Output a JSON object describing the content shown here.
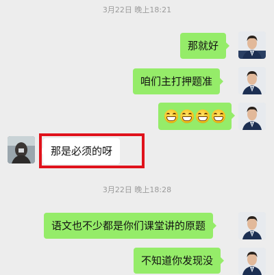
{
  "timestamps": [
    "3月22日 晚上18:21",
    "3月22日 晚上18:28"
  ],
  "messages": [
    {
      "text": "那就好"
    },
    {
      "text": "咱们主打押题准"
    },
    {
      "emoji_name": "grinning-face-icon",
      "count": 4
    },
    {
      "text": "那是必须的呀"
    },
    {
      "text": "语文也不少都是你们课堂讲的原题"
    },
    {
      "text": "不知道你发现没"
    }
  ],
  "colors": {
    "background": "#ededed",
    "outgoing_bubble": "#95ec69",
    "incoming_bubble": "#ffffff",
    "highlight_box": "#e0121b",
    "timestamp_text": "#9a9a9a"
  }
}
